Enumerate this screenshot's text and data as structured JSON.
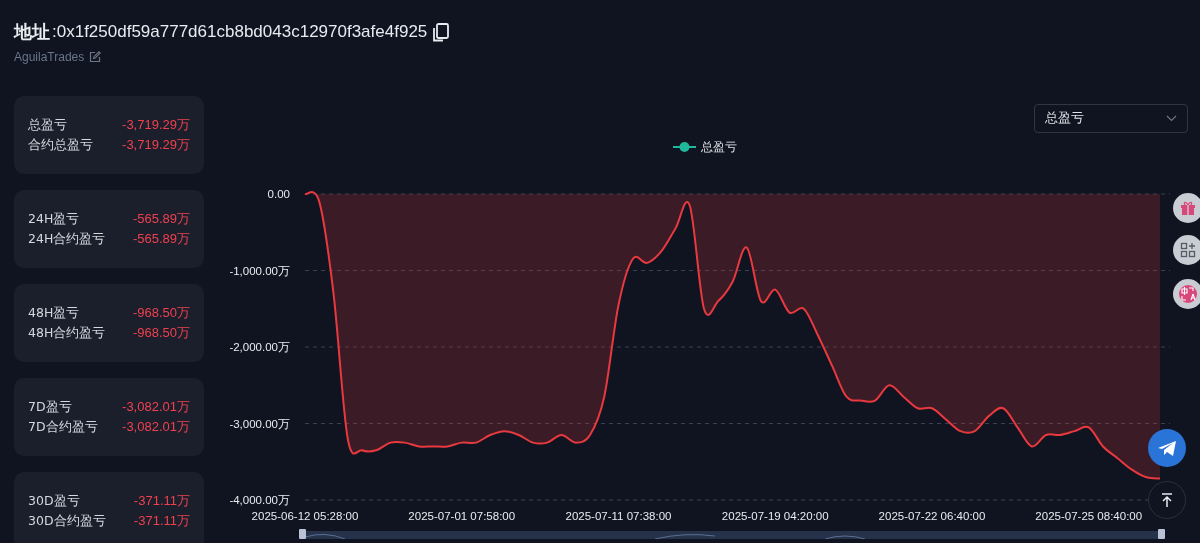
{
  "header": {
    "label": "地址",
    "address": ":0x1f250df59a777d61cb8bd043c12970f3afe4f925",
    "nickname": "AguilaTrades"
  },
  "stats": [
    {
      "rows": [
        {
          "label": "总盈亏",
          "value": "-3,719.29万"
        },
        {
          "label": "合约总盈亏",
          "value": "-3,719.29万"
        }
      ]
    },
    {
      "rows": [
        {
          "label": "24H盈亏",
          "value": "-565.89万"
        },
        {
          "label": "24H合约盈亏",
          "value": "-565.89万"
        }
      ]
    },
    {
      "rows": [
        {
          "label": "48H盈亏",
          "value": "-968.50万"
        },
        {
          "label": "48H合约盈亏",
          "value": "-968.50万"
        }
      ]
    },
    {
      "rows": [
        {
          "label": "7D盈亏",
          "value": "-3,082.01万"
        },
        {
          "label": "7D合约盈亏",
          "value": "-3,082.01万"
        }
      ]
    },
    {
      "rows": [
        {
          "label": "30D盈亏",
          "value": "-371.11万"
        },
        {
          "label": "30D合约盈亏",
          "value": "-371.11万"
        }
      ]
    }
  ],
  "metric_select": {
    "value": "总盈亏"
  },
  "chart": {
    "chart_data": {
      "type": "area",
      "grid": true,
      "categories": [
        "2025-06-12 05:28:00",
        null,
        null,
        null,
        null,
        null,
        null,
        null,
        null,
        null,
        null,
        "2025-07-01 07:58:00",
        null,
        null,
        null,
        null,
        null,
        null,
        null,
        null,
        null,
        null,
        "2025-07-11 07:38:00",
        null,
        null,
        null,
        null,
        null,
        null,
        null,
        null,
        null,
        null,
        "2025-07-19 04:20:00",
        null,
        null,
        null,
        null,
        null,
        null,
        null,
        null,
        null,
        null,
        "2025-07-22 06:40:00",
        null,
        null,
        null,
        null,
        null,
        null,
        null,
        null,
        null,
        null,
        "2025-07-25 08:40:00",
        null,
        null,
        null,
        null,
        null
      ],
      "series": [
        {
          "name": "总盈亏",
          "color": "#e8393f",
          "values": [
            0,
            -100,
            -1300,
            -3200,
            -3350,
            -3350,
            -3250,
            -3250,
            -3300,
            -3300,
            -3300,
            -3250,
            -3250,
            -3150,
            -3100,
            -3150,
            -3250,
            -3250,
            -3150,
            -3250,
            -3150,
            -2650,
            -1450,
            -850,
            -900,
            -750,
            -450,
            -150,
            -1500,
            -1400,
            -1150,
            -700,
            -1400,
            -1250,
            -1550,
            -1500,
            -1850,
            -2250,
            -2650,
            -2700,
            -2700,
            -2500,
            -2650,
            -2800,
            -2800,
            -2950,
            -3100,
            -3100,
            -2900,
            -2800,
            -3050,
            -3300,
            -3150,
            -3150,
            -3100,
            -3050,
            -3300,
            -3450,
            -3600,
            -3700,
            -3720
          ]
        }
      ],
      "ylim": [
        -4000,
        0
      ],
      "yticks": [
        {
          "value": 0,
          "label": "0.00"
        },
        {
          "value": -1000,
          "label": "-1,000.00万"
        },
        {
          "value": -2000,
          "label": "-2,000.00万"
        },
        {
          "value": -3000,
          "label": "-3,000.00万"
        },
        {
          "value": -4000,
          "label": "-4,000.00万"
        }
      ]
    }
  }
}
